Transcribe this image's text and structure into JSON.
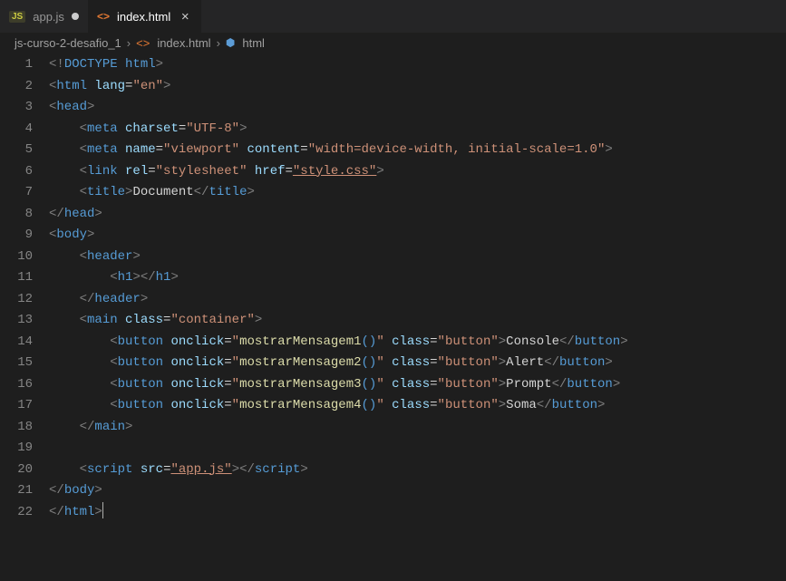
{
  "tabs": [
    {
      "icon": "JS",
      "label": "app.js",
      "modified": true,
      "active": false
    },
    {
      "icon": "<>",
      "label": "index.html",
      "modified": false,
      "active": true
    }
  ],
  "breadcrumbs": {
    "project": "js-curso-2-desafio_1",
    "file": "index.html",
    "symbol": "html"
  },
  "lineNumbers": [
    "1",
    "2",
    "3",
    "4",
    "5",
    "6",
    "7",
    "8",
    "9",
    "10",
    "11",
    "12",
    "13",
    "14",
    "15",
    "16",
    "17",
    "18",
    "19",
    "20",
    "21",
    "22"
  ],
  "code": {
    "doctype": "DOCTYPE",
    "html": "html",
    "lang_attr": "lang",
    "lang_val": "\"en\"",
    "head": "head",
    "meta": "meta",
    "charset_attr": "charset",
    "charset_val": "\"UTF-8\"",
    "name_attr": "name",
    "viewport_val": "\"viewport\"",
    "content_attr": "content",
    "content_val": "\"width=device-width, initial-scale=1.0\"",
    "link": "link",
    "rel_attr": "rel",
    "rel_val": "\"stylesheet\"",
    "href_attr": "href",
    "href_val": "\"style.css\"",
    "title_tag": "title",
    "title_text": "Document",
    "body": "body",
    "header": "header",
    "h1": "h1",
    "main": "main",
    "class_attr": "class",
    "container_val": "\"container\"",
    "button_tag": "button",
    "onclick_attr": "onclick",
    "fn1": "mostrarMensagem1",
    "fn2": "mostrarMensagem2",
    "fn3": "mostrarMensagem3",
    "fn4": "mostrarMensagem4",
    "btn_class_val": "\"button\"",
    "btn1_text": "Console",
    "btn2_text": "Alert",
    "btn3_text": "Prompt",
    "btn4_text": "Soma",
    "script": "script",
    "src_attr": "src",
    "src_val": "\"app.js\""
  }
}
